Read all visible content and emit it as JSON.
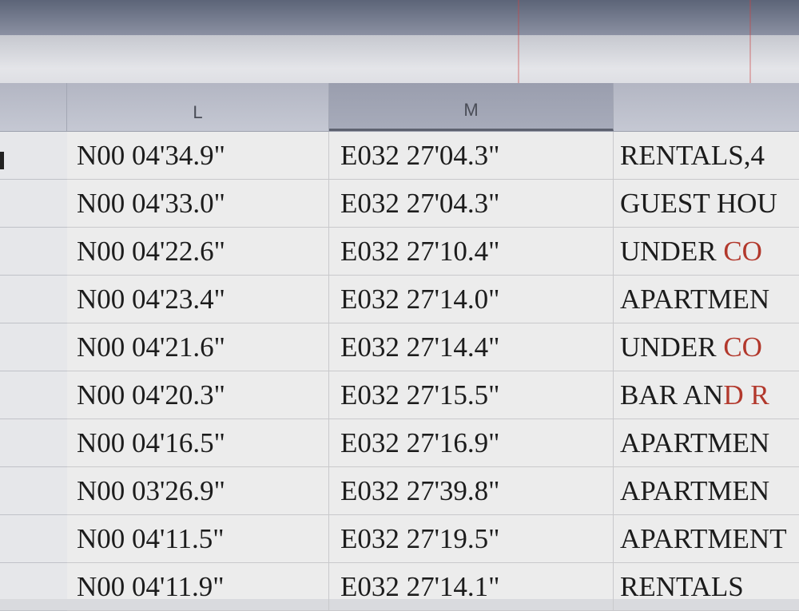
{
  "columns": {
    "l": "L",
    "m": "M"
  },
  "rows": [
    {
      "lat": "N00 04'34.9\"",
      "lon": "E032 27'04.3\"",
      "desc_a": "RENTALS,4",
      "desc_b": ""
    },
    {
      "lat": "N00 04'33.0\"",
      "lon": "E032 27'04.3\"",
      "desc_a": "GUEST HOU",
      "desc_b": ""
    },
    {
      "lat": "N00 04'22.6\"",
      "lon": "E032 27'10.4\"",
      "desc_a": "UNDER ",
      "desc_b": "CO"
    },
    {
      "lat": "N00 04'23.4\"",
      "lon": "E032 27'14.0\"",
      "desc_a": "APARTMEN",
      "desc_b": ""
    },
    {
      "lat": "N00 04'21.6\"",
      "lon": "E032 27'14.4\"",
      "desc_a": "UNDER ",
      "desc_b": "CO"
    },
    {
      "lat": "N00 04'20.3\"",
      "lon": "E032 27'15.5\"",
      "desc_a": "BAR AN",
      "desc_b": "D R"
    },
    {
      "lat": "N00 04'16.5\"",
      "lon": "E032 27'16.9\"",
      "desc_a": "APARTMEN",
      "desc_b": ""
    },
    {
      "lat": "N00 03'26.9\"",
      "lon": "E032 27'39.8\"",
      "desc_a": "APARTMEN",
      "desc_b": ""
    },
    {
      "lat": "N00 04'11.5\"",
      "lon": "E032 27'19.5\"",
      "desc_a": "APARTMENT",
      "desc_b": ""
    },
    {
      "lat": "N00 04'11.9\"",
      "lon": "E032 27'14.1\"",
      "desc_a": "RENTALS",
      "desc_b": ""
    }
  ]
}
